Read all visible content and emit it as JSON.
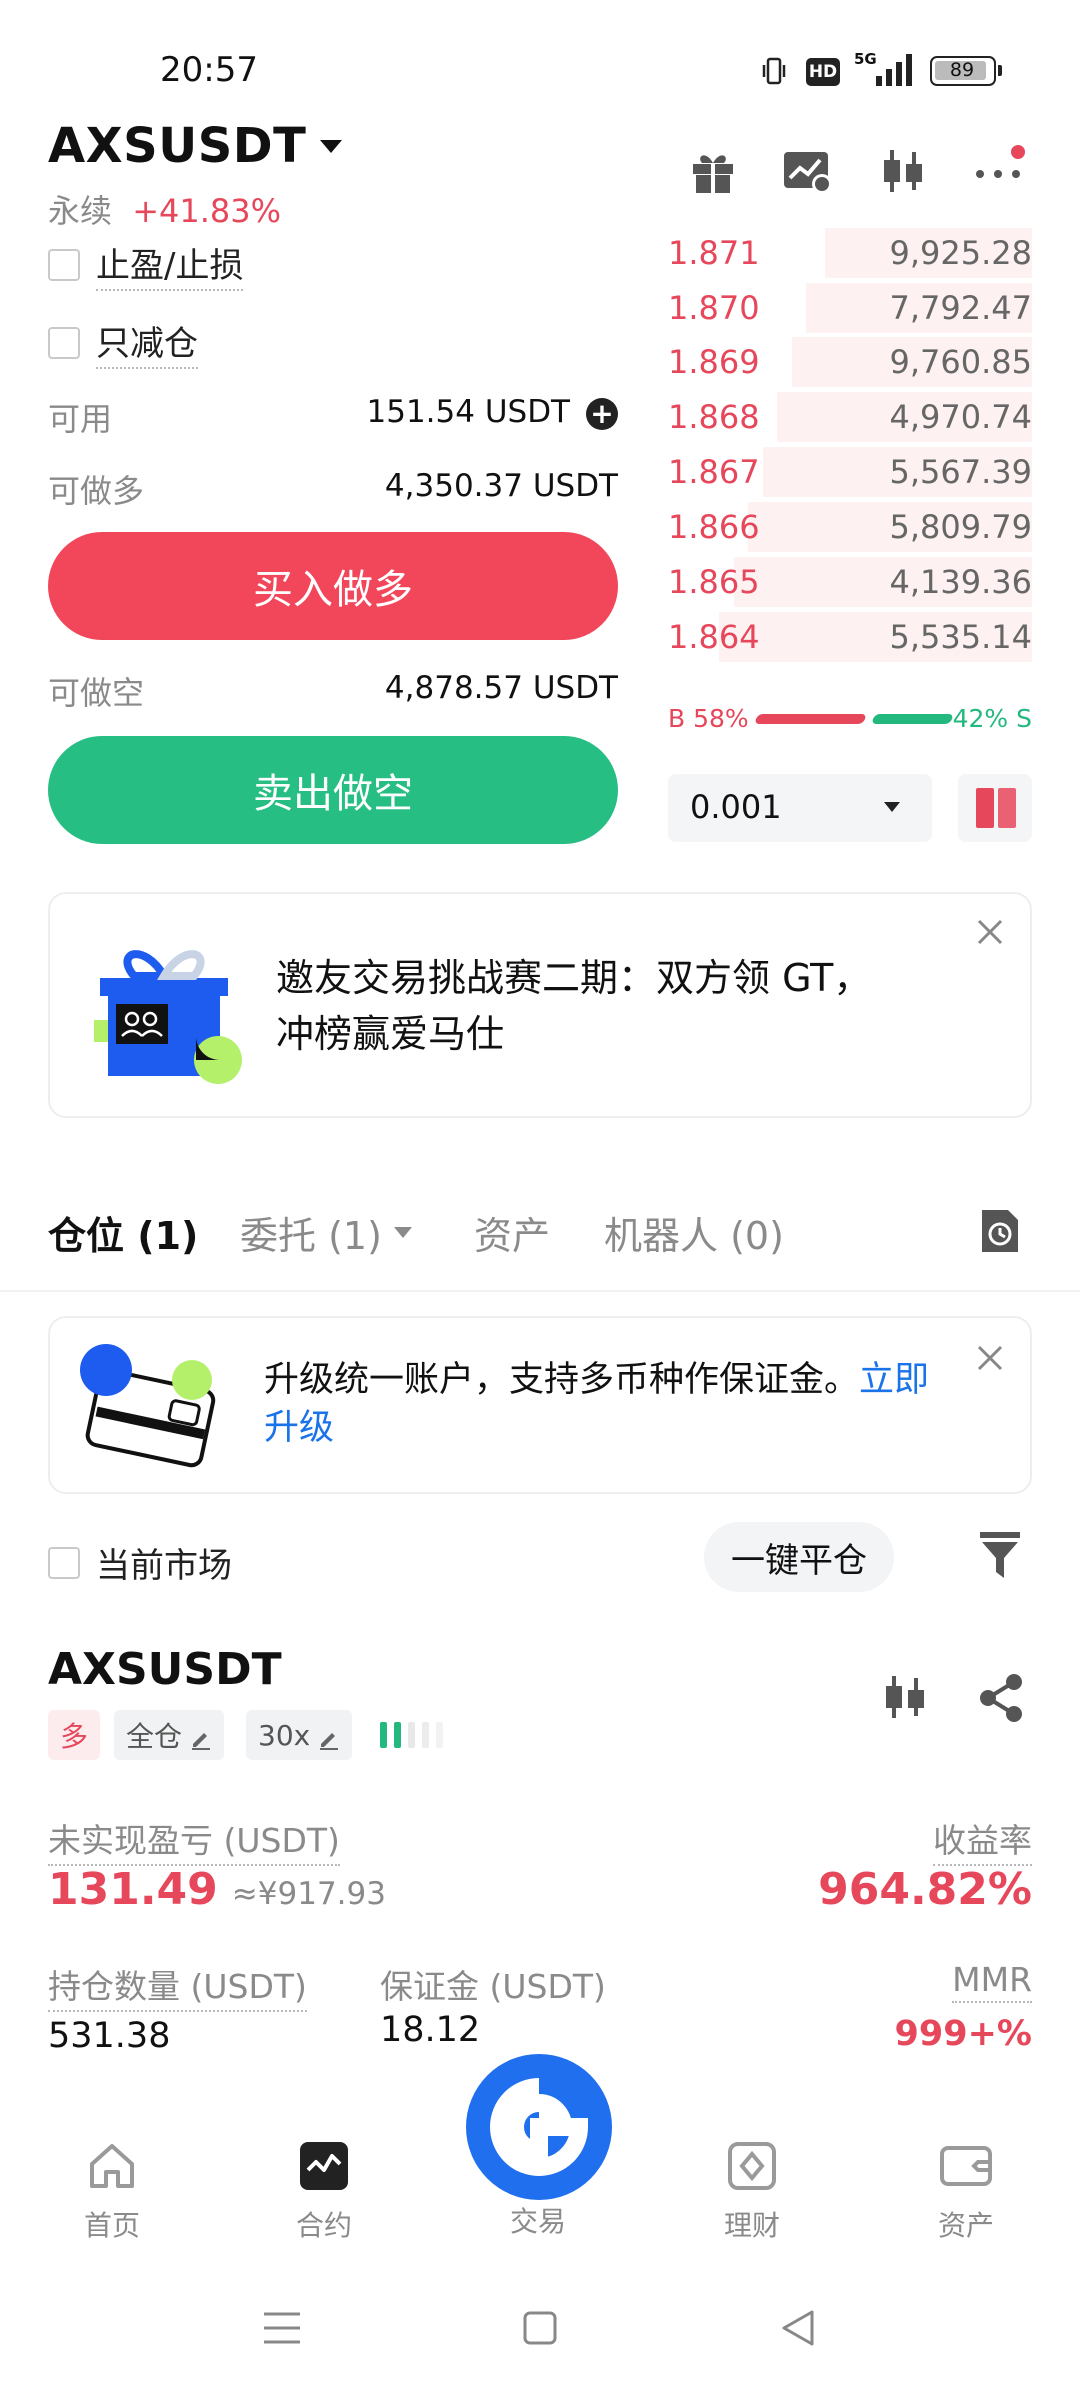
{
  "status_bar": {
    "time": "20:57",
    "battery": "89",
    "network": "5G",
    "hd": "HD"
  },
  "header": {
    "symbol": "AXSUSDT",
    "contract_type": "永续",
    "change": "+41.83%"
  },
  "order_form": {
    "tp_sl_label": "止盈/止损",
    "reduce_only_label": "只减仓",
    "available_label": "可用",
    "available_value": "151.54 USDT",
    "max_long_label": "可做多",
    "max_long_value": "4,350.37 USDT",
    "buy_button": "买入做多",
    "max_short_label": "可做空",
    "max_short_value": "4,878.57 USDT",
    "sell_button": "卖出做空"
  },
  "orderbook": {
    "asks": [
      {
        "price": "1.871",
        "qty": "9,925.28",
        "depth": 0.57
      },
      {
        "price": "1.870",
        "qty": "7,792.47",
        "depth": 0.62
      },
      {
        "price": "1.869",
        "qty": "9,760.85",
        "depth": 0.66
      },
      {
        "price": "1.868",
        "qty": "4,970.74",
        "depth": 0.7
      },
      {
        "price": "1.867",
        "qty": "5,567.39",
        "depth": 0.74
      },
      {
        "price": "1.866",
        "qty": "5,809.79",
        "depth": 0.78
      },
      {
        "price": "1.865",
        "qty": "4,139.36",
        "depth": 0.82
      },
      {
        "price": "1.864",
        "qty": "5,535.14",
        "depth": 0.86
      }
    ],
    "buy_ratio_label": "B 58%",
    "sell_ratio_label": "42% S",
    "buy_ratio": 0.58,
    "precision": "0.001"
  },
  "promo_banner": {
    "text_line1": "邀友交易挑战赛二期：双方领 GT，",
    "text_line2": "冲榜赢爱马仕"
  },
  "tabs": {
    "positions": "仓位 (1)",
    "orders": "委托 (1)",
    "assets": "资产",
    "bots": "机器人 (0)"
  },
  "upgrade_banner": {
    "text": "升级统一账户，支持多币种作保证金。",
    "link_part1": "立即",
    "link_part2": "升级"
  },
  "filters": {
    "current_market": "当前市场",
    "close_all": "一键平仓"
  },
  "position": {
    "symbol": "AXSUSDT",
    "side": "多",
    "margin_mode": "全仓",
    "leverage": "30x",
    "upnl_label": "未实现盈亏 (USDT)",
    "upnl_value": "131.49",
    "upnl_cny": "≈¥917.93",
    "roe_label": "收益率",
    "roe_value": "964.82%",
    "size_label": "持仓数量 (USDT)",
    "size_value": "531.38",
    "margin_label": "保证金 (USDT)",
    "margin_value": "18.12",
    "mmr_label": "MMR",
    "mmr_value": "999+%"
  },
  "bottom_nav": {
    "home": "首页",
    "futures": "合约",
    "trade": "交易",
    "finance": "理财",
    "assets": "资产"
  },
  "colors": {
    "red": "#e6475a",
    "green": "#23b87e",
    "blue": "#1f6fef",
    "link": "#1a73e8"
  }
}
